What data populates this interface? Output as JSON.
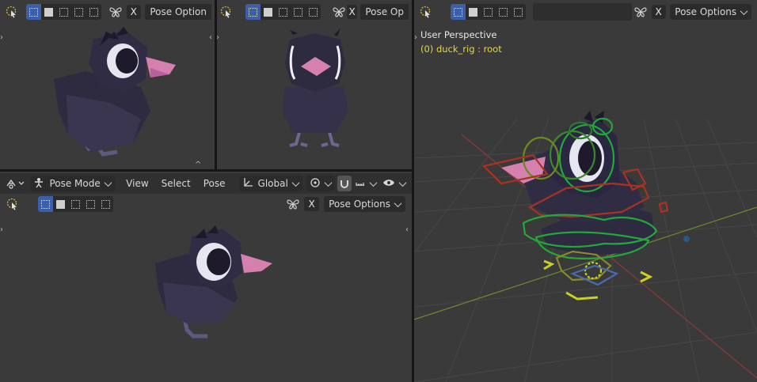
{
  "top_left": {
    "pose_options_label": "Pose Option",
    "x_label": "X"
  },
  "top_middle": {
    "pose_options_label": "Pose Op",
    "x_label": "X"
  },
  "bottom_left": {
    "mode_label": "Pose Mode",
    "menus": [
      "View",
      "Select",
      "Pose"
    ],
    "transform_orientation": "Global",
    "pose_options_label": "Pose Options",
    "x_label": "X"
  },
  "right": {
    "perspective_label": "User Perspective",
    "object_label": "(0) duck_rig : root",
    "pose_options_label": "Pose Options",
    "x_label": "X"
  },
  "colors": {
    "panel_bg": "#3a3a3a",
    "header_bg": "#2b2b2b",
    "accent": "#3d5ea8",
    "object_label": "#e6d64b",
    "duck_body": "#34304a",
    "beak": "#d680b0",
    "bone_green": "#22a83a",
    "bone_red": "#a83322",
    "bone_yellow": "#c8d020"
  }
}
